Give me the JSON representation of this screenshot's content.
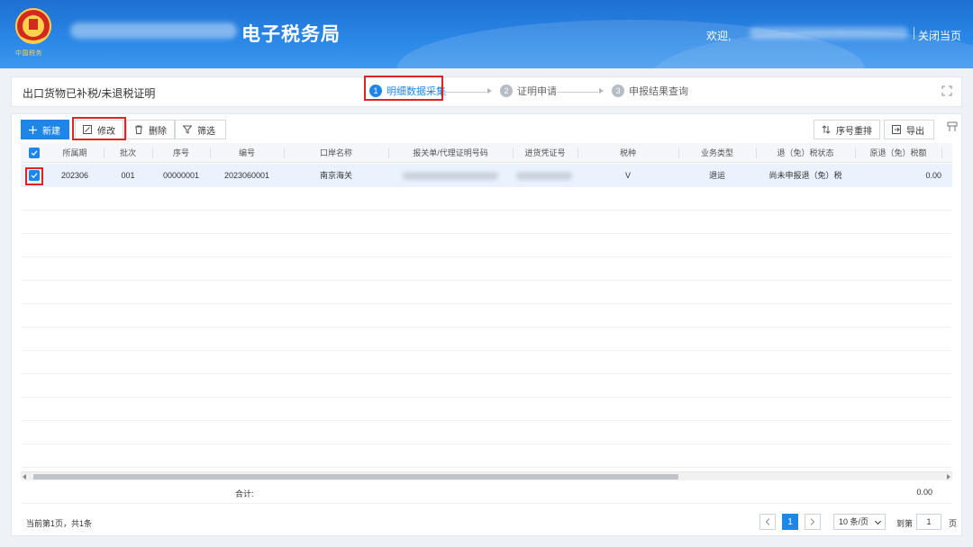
{
  "header": {
    "title": "电子税务局",
    "welcome": "欢迎,",
    "close_page": "关闭当页",
    "emblem_caption": "中国税务"
  },
  "steps": {
    "page_title": "出口货物已补税/未退税证明",
    "items": [
      {
        "num": "1",
        "label": "明细数据采集",
        "state": "active"
      },
      {
        "num": "2",
        "label": "证明申请",
        "state": "inactive"
      },
      {
        "num": "3",
        "label": "申报结果查询",
        "state": "inactive"
      }
    ]
  },
  "toolbar": {
    "new_label": "新建",
    "edit_label": "修改",
    "delete_label": "删除",
    "filter_label": "筛选",
    "reorder_label": "序号重排",
    "export_label": "导出"
  },
  "table": {
    "columns": [
      "所属期",
      "批次",
      "序号",
      "编号",
      "口岸名称",
      "报关单/代理证明号码",
      "进货凭证号",
      "税种",
      "业务类型",
      "退（免）税状态",
      "原退（免）税额"
    ],
    "rows": [
      {
        "period": "202306",
        "batch": "001",
        "seq": "00000001",
        "code": "2023060001",
        "port": "南京海关",
        "tax_type": "V",
        "biz_type": "退运",
        "status": "尚未申报退（免）税",
        "amount": "0.00"
      }
    ],
    "total_label": "合计:",
    "total_value": "0.00"
  },
  "pagination": {
    "info": "当前第1页，共1条",
    "current_page": "1",
    "page_size": "10 条/页",
    "goto_label": "到第",
    "goto_value": "1",
    "unit": "页"
  },
  "colors": {
    "primary": "#1e86e6",
    "highlight": "#e02424",
    "header_bg": "#2a86e6"
  }
}
